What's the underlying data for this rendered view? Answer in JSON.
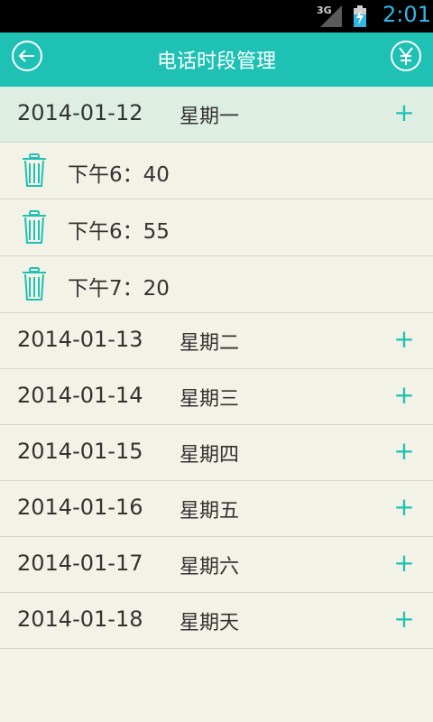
{
  "status_bar": {
    "network": "3G",
    "time": "2:01"
  },
  "header": {
    "title": "电话时段管理",
    "back_icon": "back-arrow-icon",
    "right_icon": "yen-icon"
  },
  "days": [
    {
      "date": "2014-01-12",
      "weekday": "星期一",
      "add_label": "+",
      "times": [
        "下午6：40",
        "下午6：55",
        "下午7：20"
      ]
    },
    {
      "date": "2014-01-13",
      "weekday": "星期二",
      "add_label": "+"
    },
    {
      "date": "2014-01-14",
      "weekday": "星期三",
      "add_label": "+"
    },
    {
      "date": "2014-01-15",
      "weekday": "星期四",
      "add_label": "+"
    },
    {
      "date": "2014-01-16",
      "weekday": "星期五",
      "add_label": "+"
    },
    {
      "date": "2014-01-17",
      "weekday": "星期六",
      "add_label": "+"
    },
    {
      "date": "2014-01-18",
      "weekday": "星期天",
      "add_label": "+"
    }
  ],
  "colors": {
    "accent": "#1fc1b4",
    "background": "#f3f2e6",
    "expanded_row": "#dfeee3",
    "status_text": "#33b5e5"
  }
}
